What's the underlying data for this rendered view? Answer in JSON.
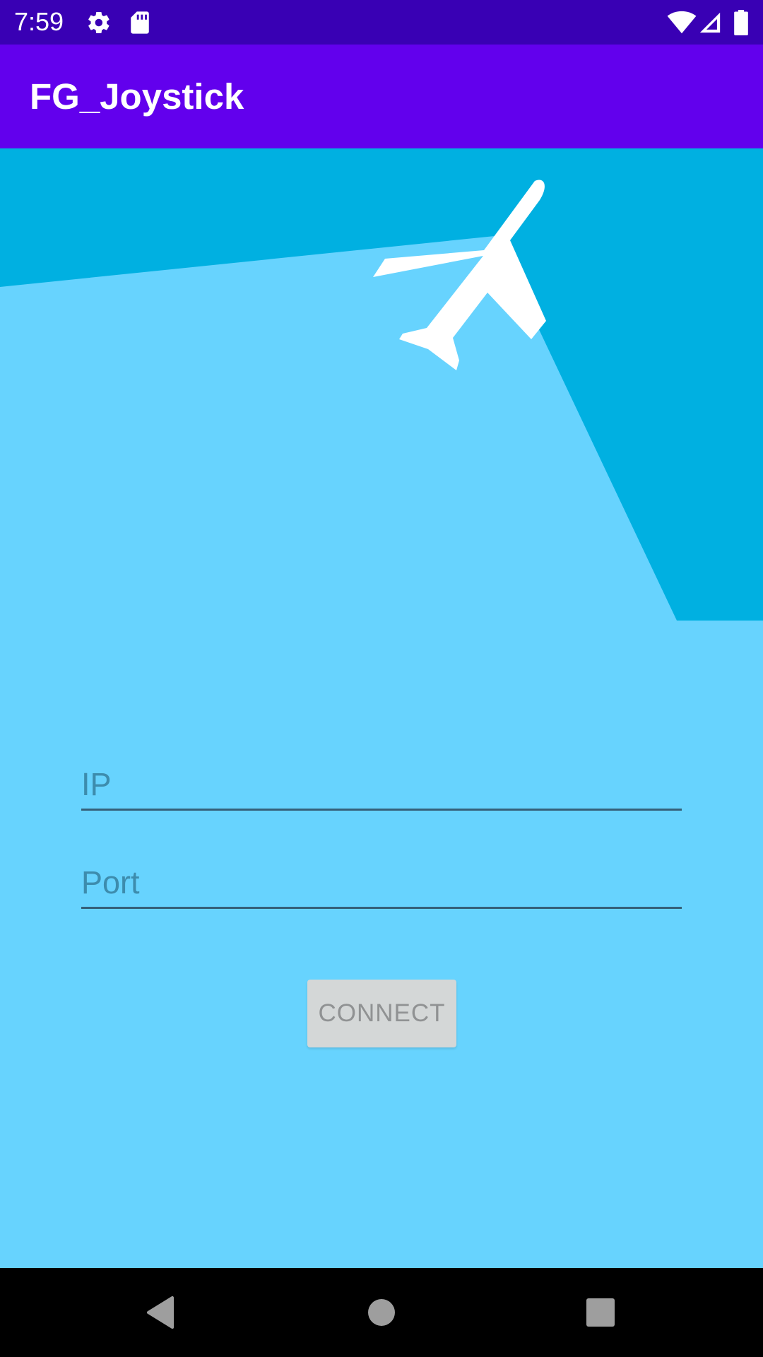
{
  "status_bar": {
    "time": "7:59",
    "icons": [
      "gear-icon",
      "sd-card-icon",
      "wifi-icon",
      "cell-signal-icon",
      "battery-icon"
    ]
  },
  "app_bar": {
    "title": "FG_Joystick"
  },
  "form": {
    "ip_placeholder": "IP",
    "ip_value": "",
    "port_placeholder": "Port",
    "port_value": "",
    "connect_label": "CONNECT"
  },
  "nav_bar": {
    "icons": [
      "back-icon",
      "home-icon",
      "recents-icon"
    ]
  },
  "colors": {
    "status_bar": "#3900b4",
    "app_bar": "#6200ed",
    "background": "#67d3fe",
    "background_dark": "#00b0e1",
    "button": "#d4d7d7",
    "button_text": "#909293"
  }
}
